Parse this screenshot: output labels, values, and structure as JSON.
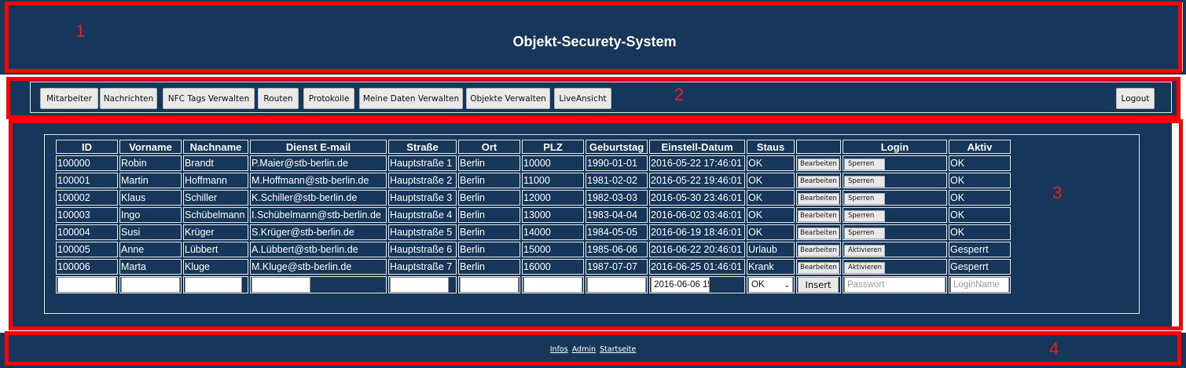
{
  "header": {
    "title": "Objekt-Securety-System"
  },
  "nav": {
    "buttons": [
      "Mitarbeiter",
      "Nachrichten",
      "NFC Tags Verwalten",
      "Routen",
      "Protokolle",
      "Meine Daten Verwalten",
      "Objekte Verwalten",
      "LiveAnsicht"
    ],
    "logout": "Logout"
  },
  "table": {
    "headers": [
      "ID",
      "Vorname",
      "Nachname",
      "Dienst E-mail",
      "Straße",
      "Ort",
      "PLZ",
      "Geburtstag",
      "Einstell-Datum",
      "Staus",
      "",
      "Login",
      "Aktiv"
    ],
    "rows": [
      {
        "id": "100000",
        "vorname": "Robin",
        "nachname": "Brandt",
        "email": "P.Maier@stb-berlin.de",
        "strasse": "Hauptstraße 1",
        "ort": "Berlin",
        "plz": "10000",
        "geburtstag": "1990-01-01",
        "einstell": "2016-05-22 17:46:01",
        "status": "OK",
        "edit": "Bearbeiten",
        "login_action": "Sperren",
        "aktiv": "OK"
      },
      {
        "id": "100001",
        "vorname": "Martin",
        "nachname": "Hoffmann",
        "email": "M.Hoffmann@stb-berlin.de",
        "strasse": "Hauptstraße 2",
        "ort": "Berlin",
        "plz": "11000",
        "geburtstag": "1981-02-02",
        "einstell": "2016-05-22 19:46:01",
        "status": "OK",
        "edit": "Bearbeiten",
        "login_action": "Sperren",
        "aktiv": "OK"
      },
      {
        "id": "100002",
        "vorname": "Klaus",
        "nachname": "Schiller",
        "email": "K.Schiller@stb-berlin.de",
        "strasse": "Hauptstraße 3",
        "ort": "Berlin",
        "plz": "12000",
        "geburtstag": "1982-03-03",
        "einstell": "2016-05-30 23:46:01",
        "status": "OK",
        "edit": "Bearbeiten",
        "login_action": "Sperren",
        "aktiv": "OK"
      },
      {
        "id": "100003",
        "vorname": "Ingo",
        "nachname": "Schübelmann",
        "email": "I.Schübelmann@stb-berlin.de",
        "strasse": "Hauptstraße 4",
        "ort": "Berlin",
        "plz": "13000",
        "geburtstag": "1983-04-04",
        "einstell": "2016-06-02 03:46:01",
        "status": "OK",
        "edit": "Bearbeiten",
        "login_action": "Sperren",
        "aktiv": "OK"
      },
      {
        "id": "100004",
        "vorname": "Susi",
        "nachname": "Krüger",
        "email": "S.Krüger@stb-berlin.de",
        "strasse": "Hauptstraße 5",
        "ort": "Berlin",
        "plz": "14000",
        "geburtstag": "1984-05-05",
        "einstell": "2016-06-19 18:46:01",
        "status": "OK",
        "edit": "Bearbeiten",
        "login_action": "Sperren",
        "aktiv": "OK"
      },
      {
        "id": "100005",
        "vorname": "Anne",
        "nachname": "Lübbert",
        "email": "A.Lübbert@stb-berlin.de",
        "strasse": "Hauptstraße 6",
        "ort": "Berlin",
        "plz": "15000",
        "geburtstag": "1985-06-06",
        "einstell": "2016-06-22 20:46:01",
        "status": "Urlaub",
        "edit": "Bearbeiten",
        "login_action": "Aktivieren",
        "aktiv": "Gesperrt"
      },
      {
        "id": "100006",
        "vorname": "Marta",
        "nachname": "Kluge",
        "email": "M.Kluge@stb-berlin.de",
        "strasse": "Hauptstraße 7",
        "ort": "Berlin",
        "plz": "16000",
        "geburtstag": "1987-07-07",
        "einstell": "2016-06-25 01:46:01",
        "status": "Krank",
        "edit": "Bearbeiten",
        "login_action": "Aktivieren",
        "aktiv": "Gesperrt"
      }
    ],
    "insert_row": {
      "date_value": "2016-06-06 15",
      "status_value": "OK",
      "insert_label": "Insert",
      "password_placeholder": "Passwort",
      "loginname_placeholder": "LoginName"
    }
  },
  "footer": {
    "links": [
      "Infos",
      "Admin",
      "Startseite"
    ]
  },
  "annotations": [
    "1",
    "2",
    "3",
    "4"
  ],
  "colors": {
    "background": "#16365a",
    "annotation_border": "#ff0000",
    "text": "#ffffff"
  }
}
